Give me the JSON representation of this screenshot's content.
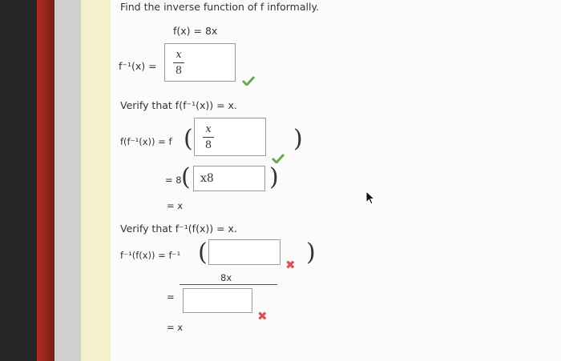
{
  "title": "Find the inverse function of f informally.",
  "given": "f(x) = 8x",
  "inverse": {
    "lhs": "f⁻¹(x) =",
    "answer_num": "x",
    "answer_den": "8"
  },
  "verify1": {
    "prompt": "Verify that f(f⁻¹(x)) = x.",
    "lhs": "f(f⁻¹(x)) = f",
    "box1_num": "x",
    "box1_den": "8",
    "line2_prefix": "= 8",
    "box2_value": "x8",
    "line3": "= x"
  },
  "verify2": {
    "prompt": "Verify that f⁻¹(f(x)) = x.",
    "lhs": "f⁻¹(f(x)) = f⁻¹",
    "numerator": "8x",
    "equals": "=",
    "line3": "= x"
  },
  "colors": {
    "correct": "#6aa84f",
    "incorrect": "#d9534f"
  },
  "icons": [
    "check-icon",
    "cross-icon",
    "mouse-cursor-icon"
  ]
}
